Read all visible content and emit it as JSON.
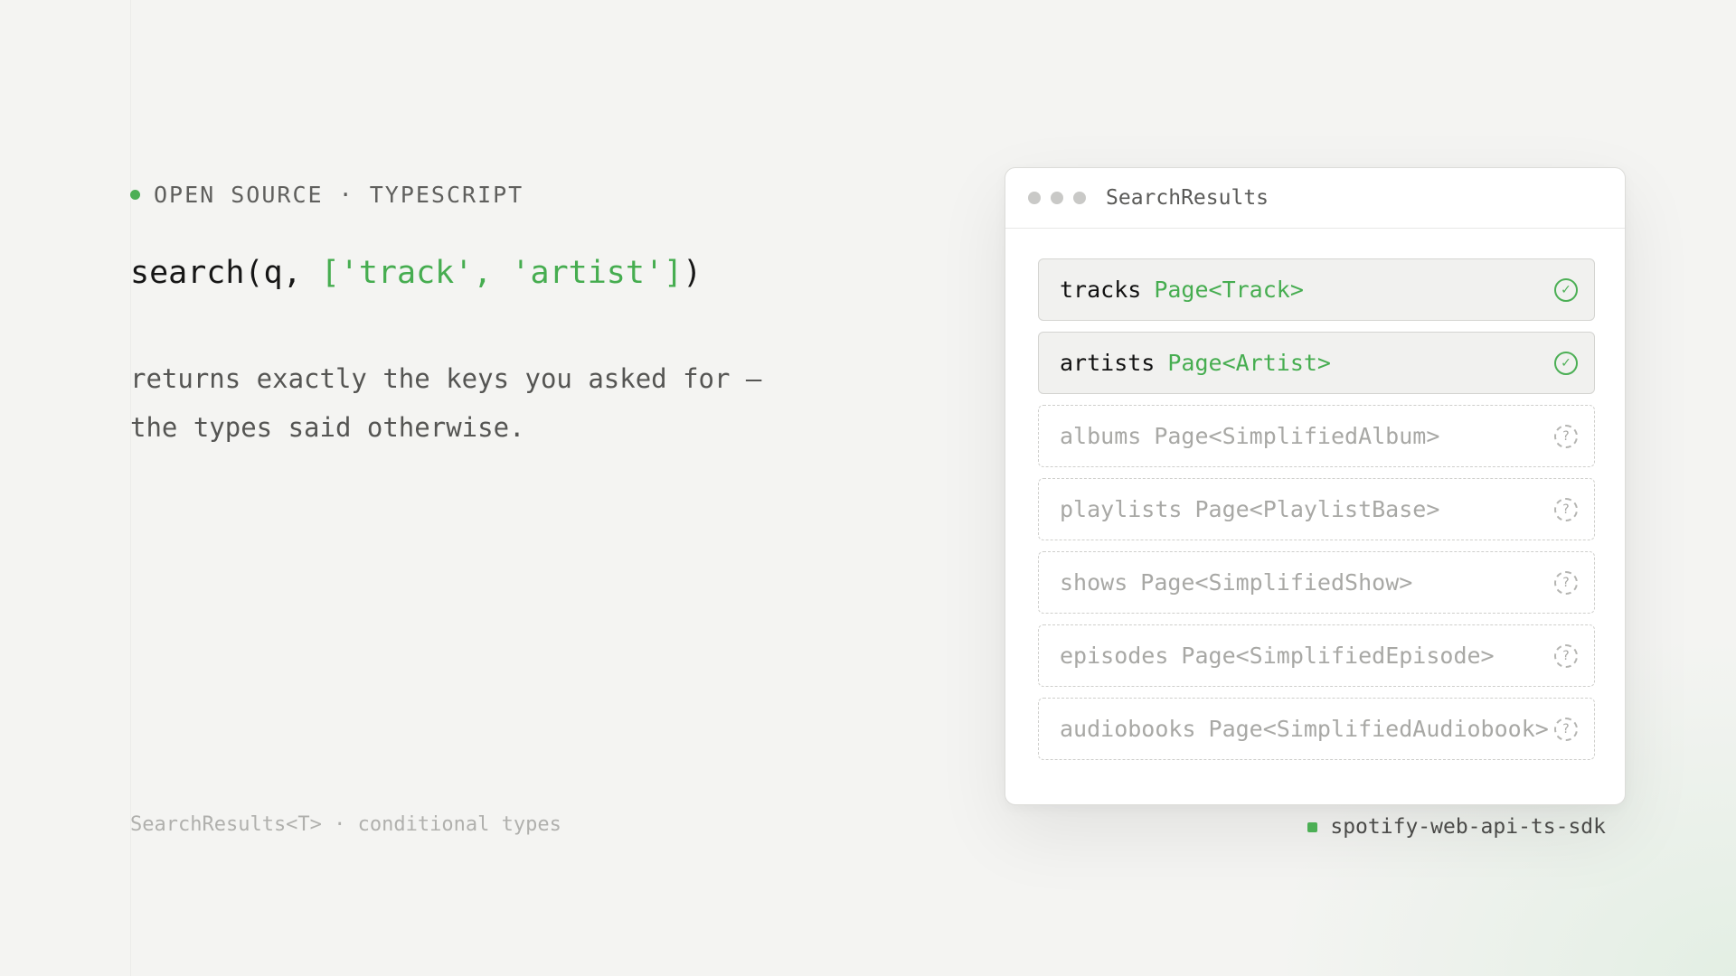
{
  "eyebrow": {
    "text": "OPEN SOURCE · TYPESCRIPT"
  },
  "code": {
    "prefix": "search(q, ",
    "highlight": "['track', 'artist']",
    "suffix": ")"
  },
  "description": {
    "line1": "returns exactly the keys you asked for —",
    "line2": "the types said otherwise."
  },
  "footnote": "SearchResults<T> · conditional types",
  "window": {
    "title": "SearchResults",
    "rows": [
      {
        "key": "tracks",
        "type": "Page<Track>",
        "status": "resolved",
        "icon": "check-circle-icon"
      },
      {
        "key": "artists",
        "type": "Page<Artist>",
        "status": "resolved",
        "icon": "check-circle-icon"
      },
      {
        "key": "albums",
        "type": "Page<SimplifiedAlbum>",
        "status": "optional",
        "icon": "question-circle-icon"
      },
      {
        "key": "playlists",
        "type": "Page<PlaylistBase>",
        "status": "optional",
        "icon": "question-circle-icon"
      },
      {
        "key": "shows",
        "type": "Page<SimplifiedShow>",
        "status": "optional",
        "icon": "question-circle-icon"
      },
      {
        "key": "episodes",
        "type": "Page<SimplifiedEpisode>",
        "status": "optional",
        "icon": "question-circle-icon"
      },
      {
        "key": "audiobooks",
        "type": "Page<SimplifiedAudiobook>",
        "status": "optional",
        "icon": "question-circle-icon"
      }
    ],
    "icons": {
      "resolved": "✓",
      "optional": "?"
    }
  },
  "badge": {
    "text": "spotify-web-api-ts-sdk"
  },
  "colors": {
    "accent": "#46ad50",
    "background": "#f4f4f2",
    "muted": "#a8a8a5"
  }
}
